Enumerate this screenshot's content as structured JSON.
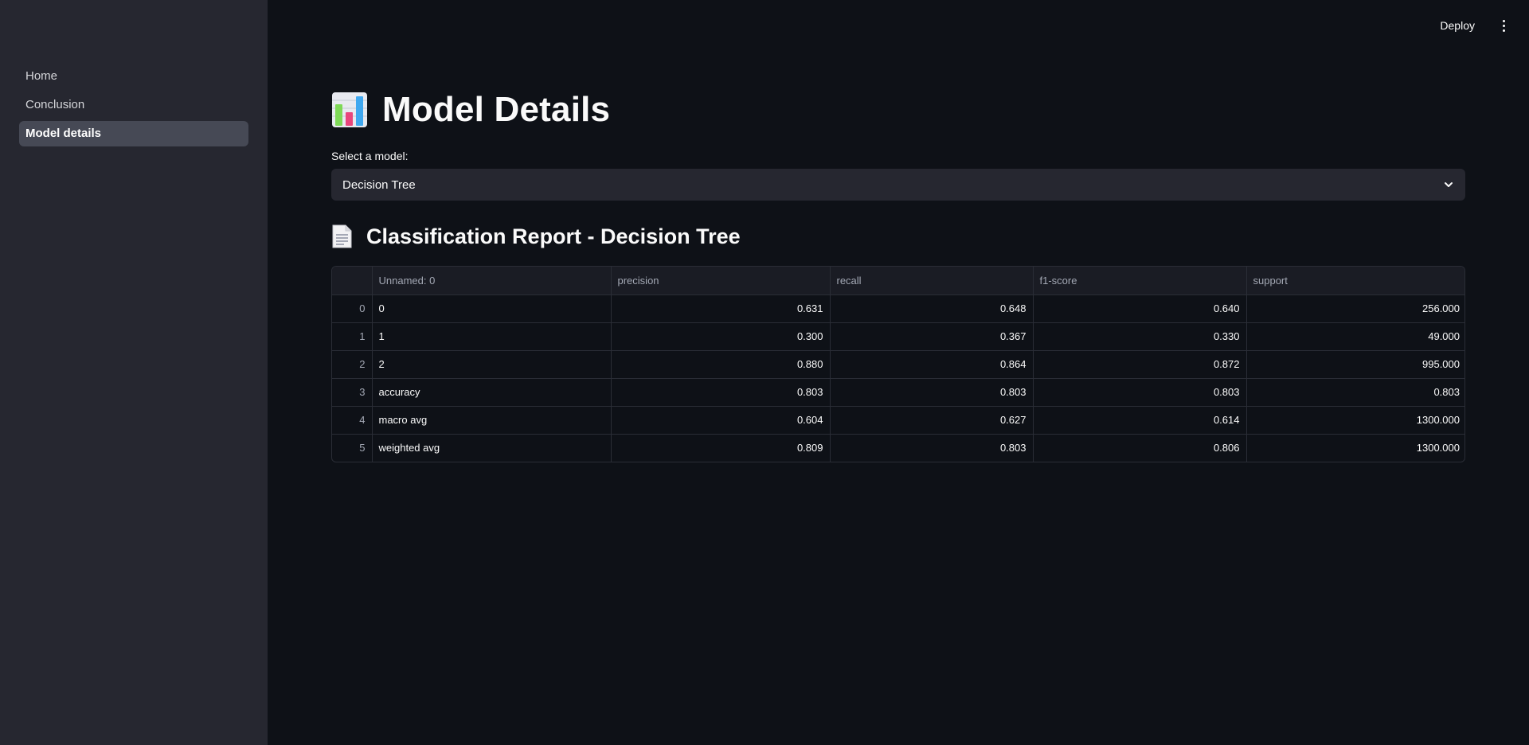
{
  "sidebar": {
    "items": [
      {
        "label": "Home"
      },
      {
        "label": "Conclusion"
      },
      {
        "label": "Model details"
      }
    ]
  },
  "header": {
    "deploy_label": "Deploy"
  },
  "main": {
    "title": "Model Details",
    "select": {
      "label": "Select a model:",
      "value": "Decision Tree"
    },
    "section_title": "Classification Report - Decision Tree",
    "table": {
      "columns": [
        "",
        "Unnamed: 0",
        "precision",
        "recall",
        "f1-score",
        "support"
      ],
      "rows": [
        [
          "0",
          "0",
          "0.631",
          "0.648",
          "0.640",
          "256.000"
        ],
        [
          "1",
          "1",
          "0.300",
          "0.367",
          "0.330",
          "49.000"
        ],
        [
          "2",
          "2",
          "0.880",
          "0.864",
          "0.872",
          "995.000"
        ],
        [
          "3",
          "accuracy",
          "0.803",
          "0.803",
          "0.803",
          "0.803"
        ],
        [
          "4",
          "macro avg",
          "0.604",
          "0.627",
          "0.614",
          "1300.000"
        ],
        [
          "5",
          "weighted avg",
          "0.809",
          "0.803",
          "0.806",
          "1300.000"
        ]
      ]
    }
  }
}
